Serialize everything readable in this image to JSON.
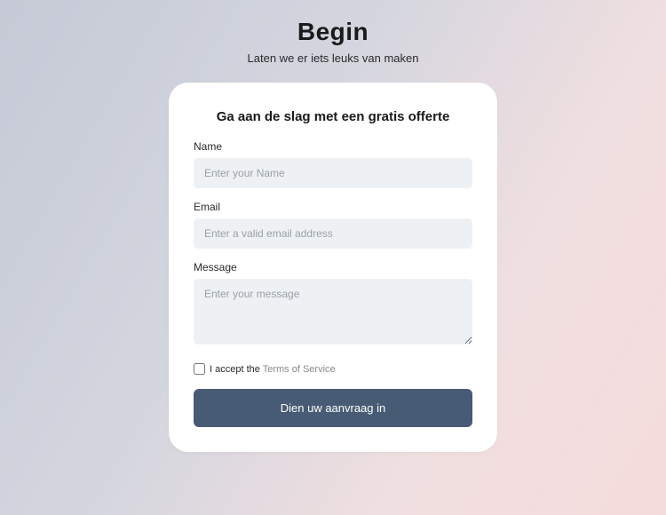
{
  "header": {
    "title": "Begin",
    "subtitle": "Laten we er iets leuks van maken"
  },
  "form": {
    "title": "Ga aan de slag met een gratis offerte",
    "name_label": "Name",
    "name_placeholder": "Enter your Name",
    "email_label": "Email",
    "email_placeholder": "Enter a valid email address",
    "message_label": "Message",
    "message_placeholder": "Enter your message",
    "tos_prefix": "I accept the ",
    "tos_link": "Terms of Service",
    "submit_label": "Dien uw aanvraag in"
  }
}
